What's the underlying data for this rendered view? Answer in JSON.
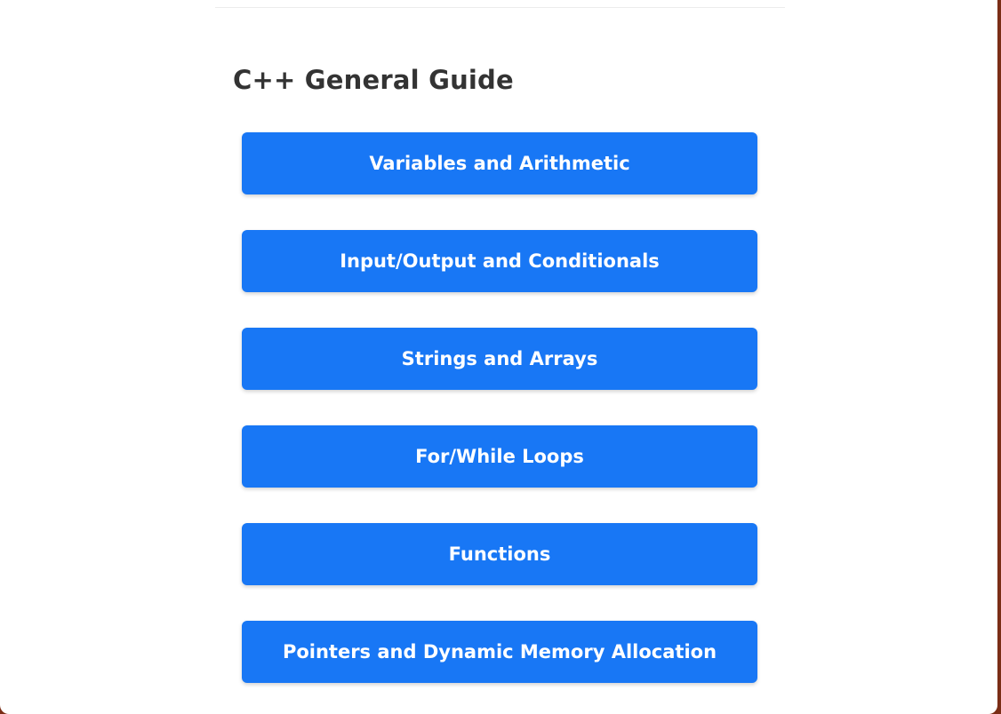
{
  "page": {
    "title": "C++ General Guide"
  },
  "guide": {
    "items": [
      {
        "label": "Variables and Arithmetic"
      },
      {
        "label": "Input/Output and Conditionals"
      },
      {
        "label": "Strings and Arrays"
      },
      {
        "label": "For/While Loops"
      },
      {
        "label": "Functions"
      },
      {
        "label": "Pointers and Dynamic Memory Allocation"
      }
    ]
  },
  "colors": {
    "button_background": "#1877f5",
    "button_text": "#ffffff",
    "title_text": "#333333",
    "page_background": "#ffffff",
    "window_edge": "#7a2d16"
  }
}
